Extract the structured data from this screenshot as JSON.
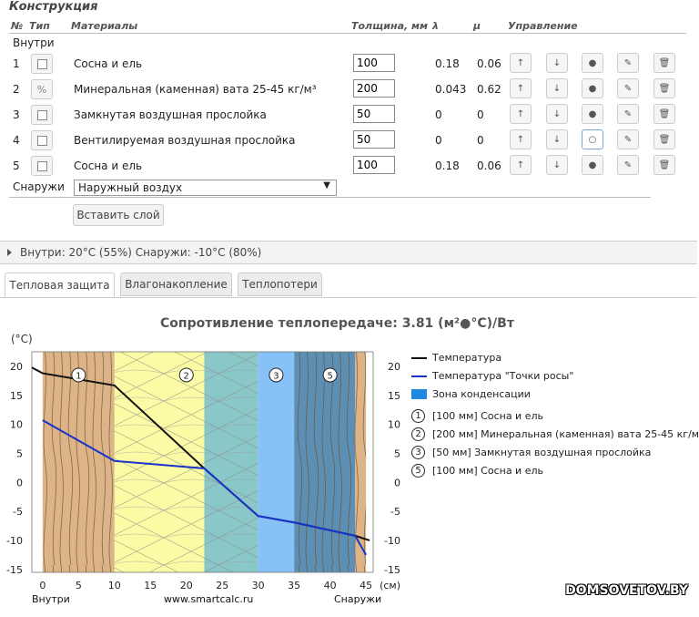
{
  "section_title": "Конструкция",
  "headers": {
    "num": "№",
    "type": "Тип",
    "materials": "Материалы",
    "thickness": "Толщина, мм",
    "lambda": "λ",
    "mu": "μ",
    "control": "Управление"
  },
  "inside_label": "Внутри",
  "outside_label": "Снаружи",
  "rows": [
    {
      "num": "1",
      "type_icon": "square-icon",
      "type_glyph": "",
      "material": "Сосна и ель",
      "thickness": "100",
      "lambda": "0.18",
      "mu": "0.06",
      "selected": false
    },
    {
      "num": "2",
      "type_icon": "percent-icon",
      "type_glyph": "%",
      "material": "Минеральная (каменная) вата 25-45 кг/м³",
      "thickness": "200",
      "lambda": "0.043",
      "mu": "0.62",
      "selected": false
    },
    {
      "num": "3",
      "type_icon": "square-icon",
      "type_glyph": "",
      "material": "Замкнутая воздушная прослойка",
      "thickness": "50",
      "lambda": "0",
      "mu": "0",
      "selected": false
    },
    {
      "num": "4",
      "type_icon": "square-icon",
      "type_glyph": "",
      "material": "Вентилируемая воздушная прослойка",
      "thickness": "50",
      "lambda": "0",
      "mu": "0",
      "selected": true
    },
    {
      "num": "5",
      "type_icon": "square-icon",
      "type_glyph": "",
      "material": "Сосна и ель",
      "thickness": "100",
      "lambda": "0.18",
      "mu": "0.06",
      "selected": false
    }
  ],
  "control_glyphs": {
    "up": "↑",
    "down": "↓",
    "dot": "●",
    "ring": "○",
    "edit": "✎",
    "delete": "🗑"
  },
  "outside_select": "Наружный воздух",
  "insert_button": "Вставить слой",
  "conditions": "Внутри: 20°C (55%) Снаружи: -10°C (80%)",
  "tabs": [
    {
      "label": "Тепловая защита",
      "active": true
    },
    {
      "label": "Влагонакопление",
      "active": false
    },
    {
      "label": "Теплопотери",
      "active": false
    }
  ],
  "chart_data": {
    "type": "line",
    "title": "Сопротивление теплопередаче: 3.81 (м²●°C)/Вт",
    "ylabel": "(°C)",
    "xlabel": "(см)",
    "xlim": [
      -1.5,
      46
    ],
    "ylim": [
      -15.5,
      22.5
    ],
    "xticks": [
      0,
      5,
      10,
      15,
      20,
      25,
      30,
      35,
      40,
      45
    ],
    "yticks": [
      -15,
      -10,
      -5,
      0,
      5,
      10,
      15,
      20
    ],
    "footer_left": "Внутри",
    "footer_center": "www.smartcalc.ru",
    "footer_right": "Снаружи",
    "layers": [
      {
        "x0": 0,
        "x1": 10,
        "kind": "wood",
        "color": "#dcb487",
        "label": "1"
      },
      {
        "x0": 10,
        "x1": 22.5,
        "kind": "wool",
        "color": "#fbfba6",
        "label": "2"
      },
      {
        "x0": 22.5,
        "x1": 30,
        "kind": "wool-cond",
        "color": "#8ac7c8",
        "label": ""
      },
      {
        "x0": 30,
        "x1": 35,
        "kind": "air",
        "color": "#86c1f7",
        "label": "3"
      },
      {
        "x0": 35,
        "x1": 43.5,
        "kind": "wood-cond",
        "color": "#5d8fb4",
        "label": "5"
      },
      {
        "x0": 43.5,
        "x1": 45,
        "kind": "wood",
        "color": "#dcb487",
        "label": ""
      }
    ],
    "label_positions": [
      {
        "label": "1",
        "x": 5,
        "y": 18.5
      },
      {
        "label": "2",
        "x": 20,
        "y": 18.5
      },
      {
        "label": "3",
        "x": 32.5,
        "y": 18.5
      },
      {
        "label": "5",
        "x": 40,
        "y": 18.5
      }
    ],
    "series": [
      {
        "name": "Температура",
        "color": "#111111",
        "x": [
          -1.5,
          0,
          10,
          22.5,
          30,
          35,
          43.5,
          45.5
        ],
        "y": [
          19.8,
          18.8,
          16.7,
          2.4,
          -5.8,
          -6.9,
          -9.2,
          -10.0
        ]
      },
      {
        "name": "Температура \"Точки росы\"",
        "color": "#1a33cc",
        "x": [
          0,
          10,
          22.5,
          30,
          35,
          43.5,
          45
        ],
        "y": [
          10.7,
          3.7,
          2.4,
          -5.8,
          -6.9,
          -9.2,
          -12.5
        ]
      }
    ],
    "legend": {
      "condensation": "Зона конденсации",
      "layers": [
        {
          "num": "1",
          "text": "[100 мм] Сосна и ель"
        },
        {
          "num": "2",
          "text": "[200 мм] Минеральная (каменная) вата 25-45 кг/м³"
        },
        {
          "num": "3",
          "text": "[50 мм] Замкнутая воздушная прослойка"
        },
        {
          "num": "5",
          "text": "[100 мм] Сосна и ель"
        }
      ]
    }
  },
  "watermark": "DOMSOVETOV.BY"
}
